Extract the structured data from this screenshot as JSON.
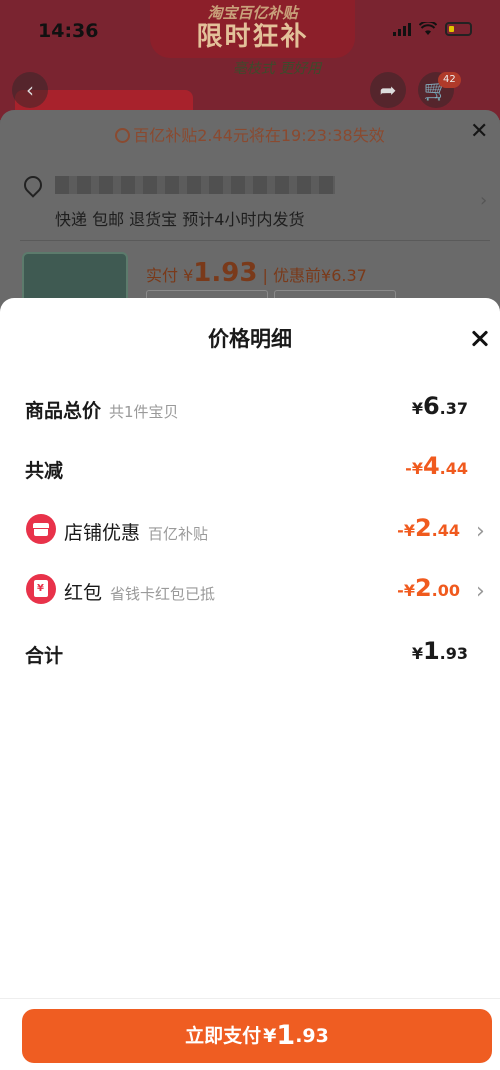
{
  "status_bar": {
    "time": "14:36"
  },
  "background": {
    "banner_line1": "淘宝百亿补贴",
    "banner_line2": "限时狂补",
    "slogan": "毫枝式 更好用",
    "cart_badge": "42",
    "expire_notice": "百亿补贴2.44元将在19:23:38失效",
    "delivery_info": "快递 包邮 退货宝 预计4小时内发货",
    "price_label": "实付",
    "price_currency": "¥",
    "price_value": "1.93",
    "price_separator": "|",
    "price_before": "优惠前¥6.37"
  },
  "sheet": {
    "title": "价格明细",
    "rows": [
      {
        "label": "商品总价",
        "sub": "共1件宝贝",
        "currency": "¥",
        "int": "6",
        "dec": ".37"
      },
      {
        "label": "共减",
        "currency": "-¥",
        "int": "4",
        "dec": ".44"
      },
      {
        "label": "店铺优惠",
        "sub": "百亿补贴",
        "currency": "-¥",
        "int": "2",
        "dec": ".44",
        "icon": "shop-icon"
      },
      {
        "label": "红包",
        "sub": "省钱卡红包已抵",
        "currency": "-¥",
        "int": "2",
        "dec": ".00",
        "icon": "red-envelope-icon"
      },
      {
        "label": "合计",
        "currency": "¥",
        "int": "1",
        "dec": ".93"
      }
    ],
    "pay_button": {
      "label": "立即支付",
      "currency": "¥",
      "int": "1",
      "dec": ".93"
    }
  },
  "colors": {
    "accent": "#ef5d22",
    "discount_red": "#f05a1e",
    "icon_red": "#e8324a"
  }
}
